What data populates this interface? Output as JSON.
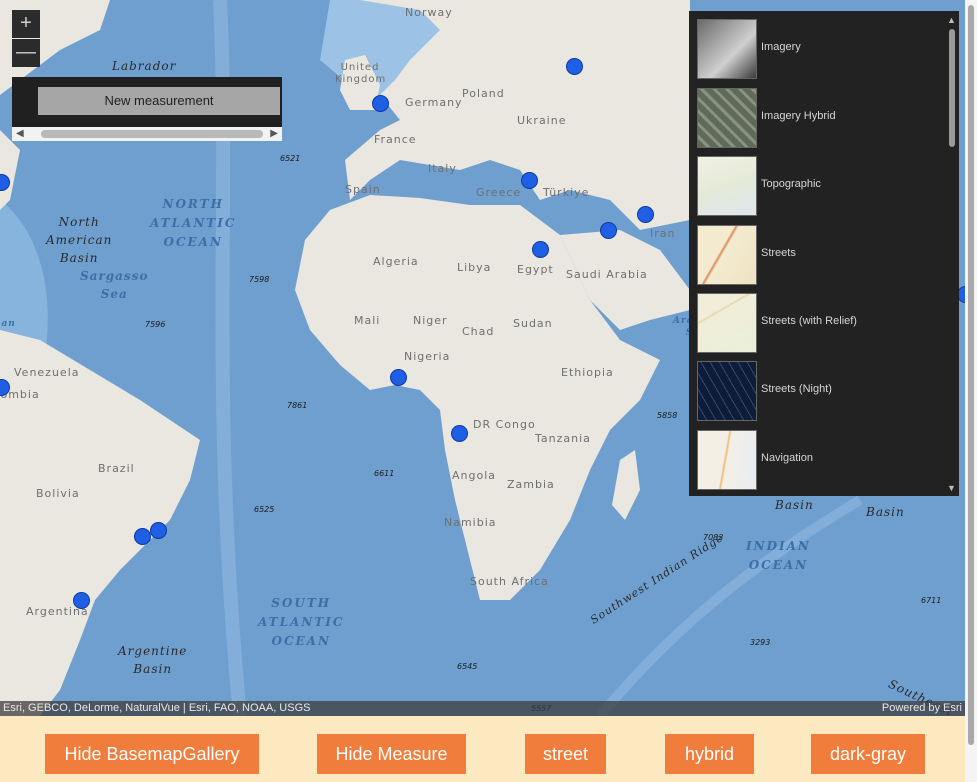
{
  "map": {
    "countries": [
      "Norway",
      "United Kingdom",
      "Poland",
      "Germany",
      "Ukraine",
      "France",
      "Italy",
      "Spain",
      "Greece",
      "Türkiye",
      "Iran",
      "Algeria",
      "Libya",
      "Egypt",
      "Saudi Arabia",
      "Mali",
      "Niger",
      "Chad",
      "Sudan",
      "Nigeria",
      "Ethiopia",
      "Venezuela",
      "Colombia",
      "Brazil",
      "DR Congo",
      "Tanzania",
      "Angola",
      "Zambia",
      "Bolivia",
      "Namibia",
      "South Africa",
      "Argentina"
    ],
    "oceans": [
      "NORTH\nATLANTIC\nOCEAN",
      "SOUTH\nATLANTIC\nOCEAN",
      "INDIAN\nOCEAN"
    ],
    "seas": [
      "Sargasso\nSea",
      "Caribbean\nSea",
      "Arabian\nSea"
    ],
    "features": [
      "Labrador",
      "North\nAmerican\nBasin",
      "Argentine\nBasin",
      "Southwest Indian Ridge",
      "Basin",
      "Basin",
      "Southeast"
    ],
    "depths": [
      "6521",
      "7598",
      "7596",
      "7861",
      "6611",
      "6525",
      "5858",
      "7083",
      "6711",
      "3293",
      "6545",
      "5557"
    ],
    "pins_count": 15
  },
  "zoom": {
    "in_label": "+",
    "out_label": "—"
  },
  "measure": {
    "new_label": "New measurement"
  },
  "gallery": {
    "items": [
      {
        "label": "Imagery",
        "thumb": "imagery"
      },
      {
        "label": "Imagery Hybrid",
        "thumb": "imagery-hybrid"
      },
      {
        "label": "Topographic",
        "thumb": "topographic"
      },
      {
        "label": "Streets",
        "thumb": "streets"
      },
      {
        "label": "Streets (with Relief)",
        "thumb": "streets-relief"
      },
      {
        "label": "Streets (Night)",
        "thumb": "streets-night"
      },
      {
        "label": "Navigation",
        "thumb": "navigation"
      }
    ]
  },
  "attribution": {
    "left": "Esri, GEBCO, DeLorme, NaturalVue | Esri, FAO, NOAA, USGS",
    "right": "Powered by Esri"
  },
  "buttons": {
    "hide_gallery": "Hide BasemapGallery",
    "hide_measure": "Hide Measure",
    "street": "street",
    "hybrid": "hybrid",
    "dark_gray": "dark-gray"
  },
  "colors": {
    "ocean": "#6f9fcf",
    "land": "#e9e7df",
    "pin": "#1f5fe6",
    "button": "#f07d3b",
    "page_bg": "#fde9c0",
    "panel": "#222222"
  }
}
